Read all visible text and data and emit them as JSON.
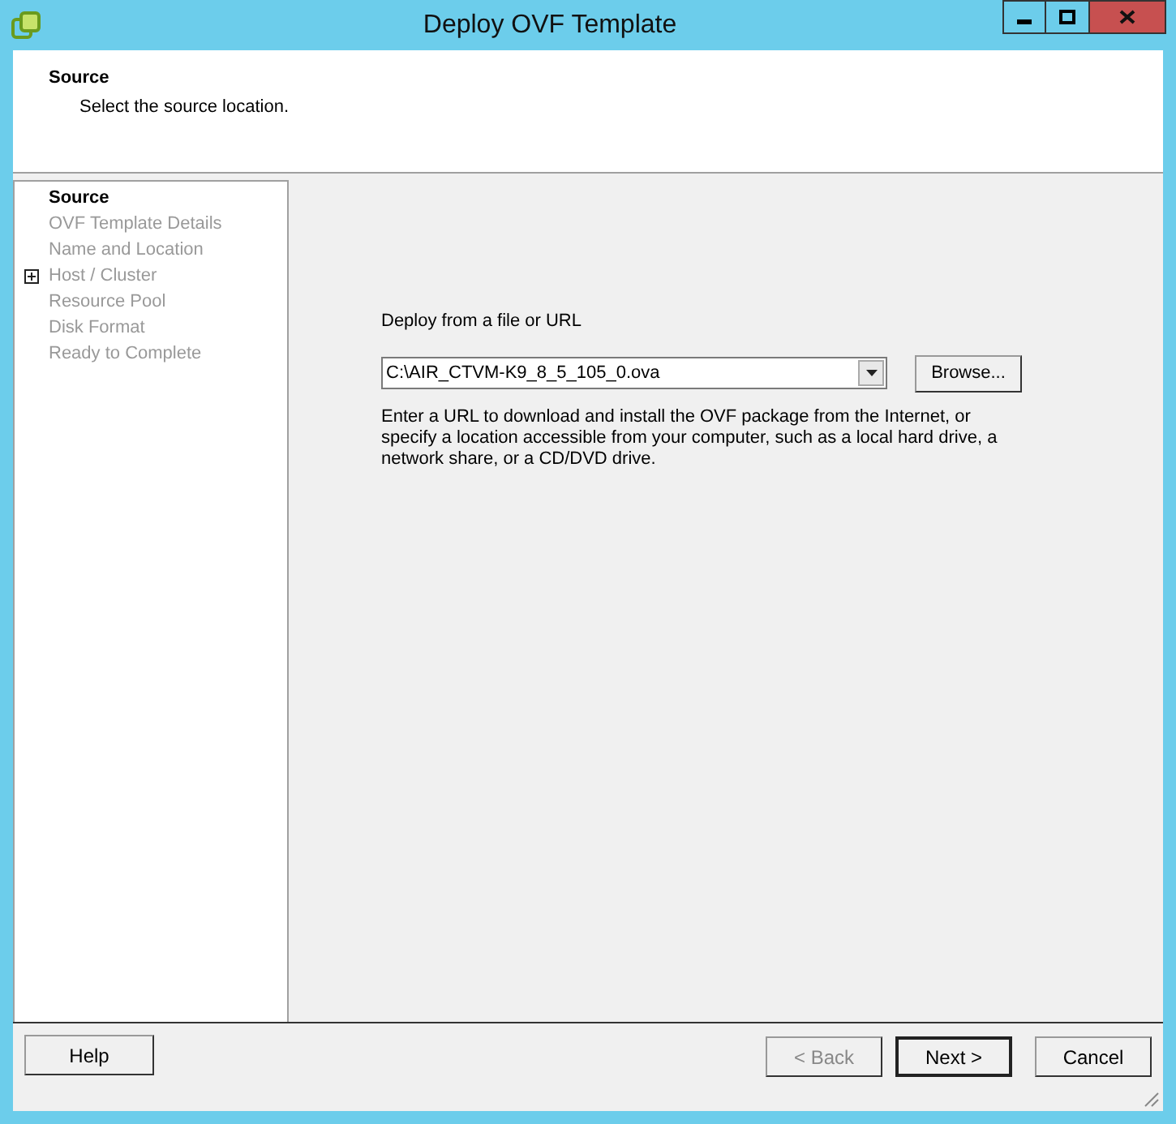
{
  "window": {
    "title": "Deploy OVF Template"
  },
  "header": {
    "title": "Source",
    "subtitle": "Select the source location."
  },
  "steps": [
    {
      "label": "Source",
      "selected": true
    },
    {
      "label": "OVF Template Details",
      "selected": false
    },
    {
      "label": "Name and Location",
      "selected": false
    },
    {
      "label": "Host / Cluster",
      "selected": false,
      "expanded": false
    },
    {
      "label": "Resource Pool",
      "selected": false
    },
    {
      "label": "Disk Format",
      "selected": false
    },
    {
      "label": "Ready to Complete",
      "selected": false
    }
  ],
  "source": {
    "label": "Deploy from a file or URL",
    "value": "C:\\AIR_CTVM-K9_8_5_105_0.ova",
    "browse": "Browse...",
    "help_text": "Enter a URL to download and install the OVF package from the Internet, or specify a location accessible from your computer, such as a local hard drive, a network share, or a CD/DVD drive."
  },
  "buttons": [
    {
      "label": "Help",
      "disabled": false,
      "default": false
    },
    {
      "label": "< Back",
      "disabled": true,
      "default": false
    },
    {
      "label": "Next >",
      "disabled": false,
      "default": true
    },
    {
      "label": "Cancel",
      "disabled": false,
      "default": false
    }
  ]
}
